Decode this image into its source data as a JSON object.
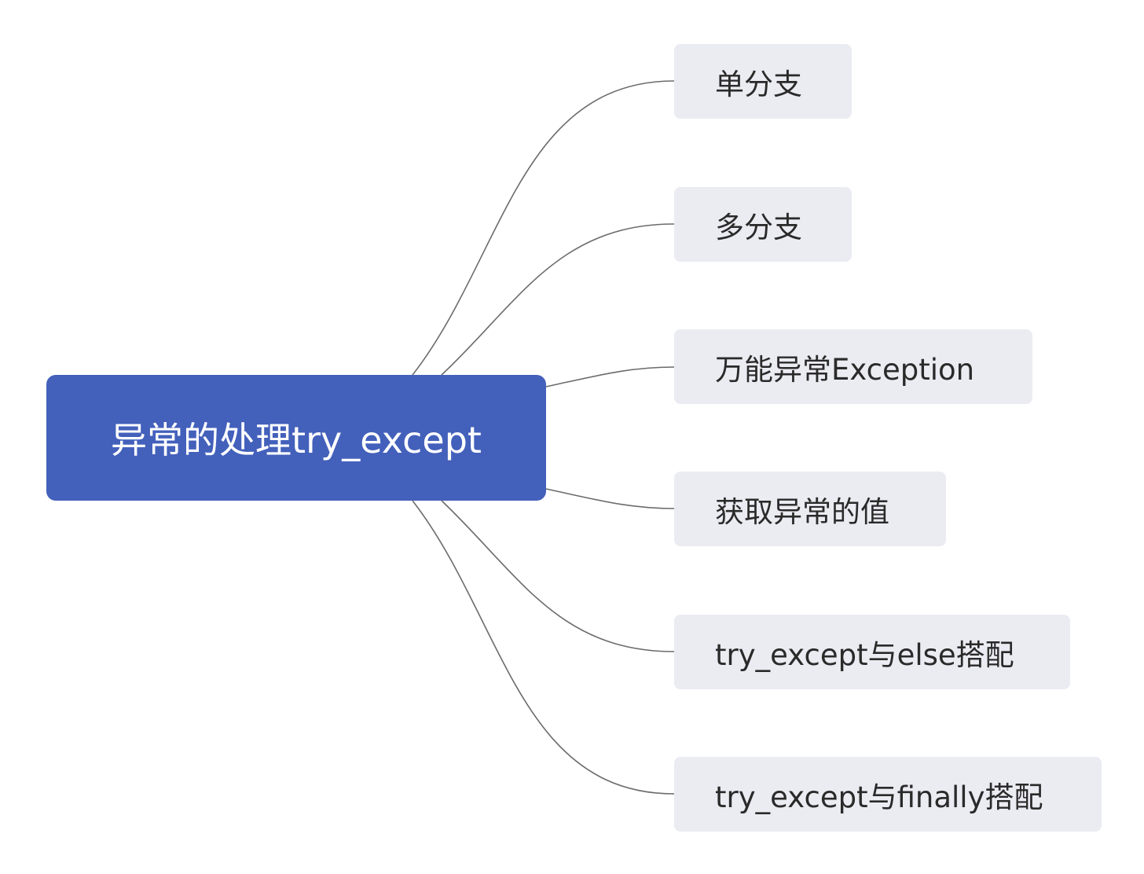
{
  "diagram": {
    "root": {
      "label": "异常的处理try_except",
      "fill": "#4360bb",
      "text_color": "#ffffff"
    },
    "children": [
      {
        "label": "单分支"
      },
      {
        "label": "多分支"
      },
      {
        "label": "万能异常Exception"
      },
      {
        "label": "获取异常的值"
      },
      {
        "label": "try_except与else搭配"
      },
      {
        "label": "try_except与finally搭配"
      }
    ],
    "child_fill": "#ebebf2",
    "connector_color": "#6b6b6b"
  }
}
